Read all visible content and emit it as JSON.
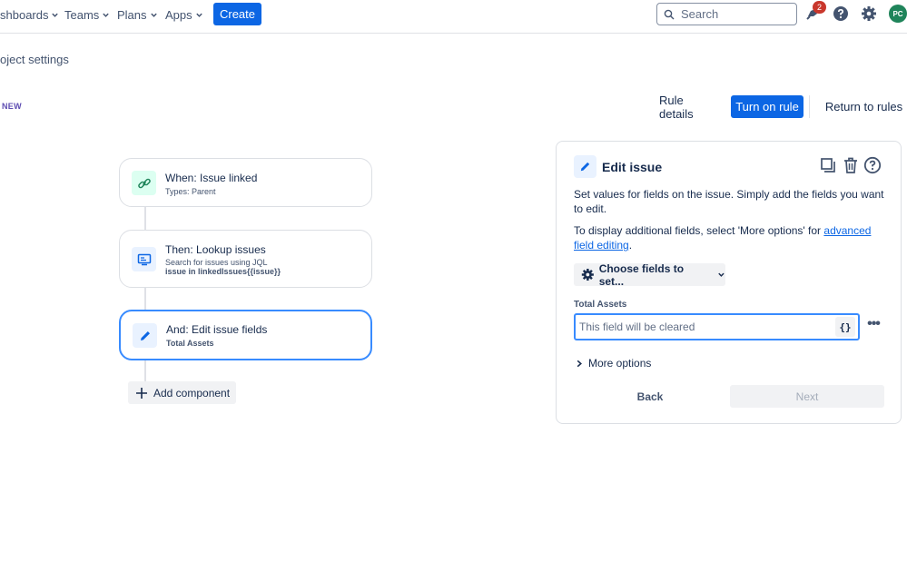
{
  "nav": {
    "items": [
      {
        "label": "shboards"
      },
      {
        "label": "Teams"
      },
      {
        "label": "Plans"
      },
      {
        "label": "Apps"
      }
    ],
    "create_label": "Create",
    "search_placeholder": "Search",
    "notification_count": "2",
    "avatar_initials": "PC"
  },
  "breadcrumb": "oject settings",
  "lozenge": "NEW",
  "header_actions": {
    "rule_details": "Rule details",
    "turn_on": "Turn on rule",
    "return": "Return to rules"
  },
  "flow": {
    "trigger": {
      "title": "When: Issue linked",
      "sub": "Types: Parent",
      "icon": "link-icon"
    },
    "lookup": {
      "title": "Then: Lookup issues",
      "sub": "Search for issues using JQL",
      "detail": "issue in linkedIssues{{issue}}",
      "icon": "lookup-icon"
    },
    "edit": {
      "title": "And: Edit issue fields",
      "detail": "Total Assets",
      "icon": "pencil-icon"
    },
    "add_label": "Add component"
  },
  "panel": {
    "title": "Edit issue",
    "desc1": "Set values for fields on the issue. Simply add the fields you want to edit.",
    "desc2_prefix": "To display additional fields, select 'More options' for ",
    "desc2_link": "advanced field editing",
    "desc2_suffix": ".",
    "choose_fields": "Choose fields to set...",
    "field_label": "Total Assets",
    "field_placeholder": "This field will be cleared",
    "brace_label": "{}",
    "more_options": "More options",
    "back": "Back",
    "next": "Next"
  },
  "colors": {
    "primary": "#0c66e4",
    "selected_border": "#388bff",
    "trigger_green": "#dcfff1",
    "badge_red": "#c9372c",
    "avatar_green": "#1f845a"
  }
}
